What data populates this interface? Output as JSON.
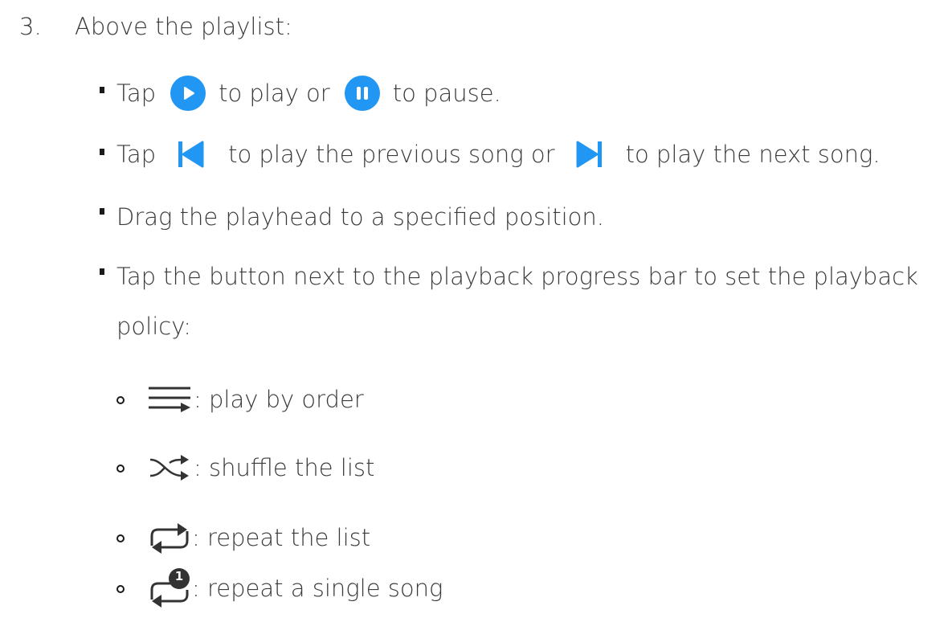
{
  "step": {
    "number": "3.",
    "title": "Above the playlist:"
  },
  "bullets": {
    "play_pause": {
      "tap": "Tap",
      "mid": "to play or",
      "end": "to pause."
    },
    "prev_next": {
      "tap": "Tap",
      "mid": "to play the previous song or",
      "end": "to play the next song."
    },
    "drag": "Drag the playhead to a specified position.",
    "policy_line1": "Tap the button next to the playback progress bar to set the playback",
    "policy_line2": "policy:"
  },
  "policies": [
    {
      "icon": "play-by-order-icon",
      "label": ": play by order"
    },
    {
      "icon": "shuffle-icon",
      "label": ": shuffle the list"
    },
    {
      "icon": "repeat-list-icon",
      "label": ": repeat the list"
    },
    {
      "icon": "repeat-single-icon",
      "label": ": repeat a single song",
      "badge": "1"
    }
  ],
  "colors": {
    "accent": "#2196F3",
    "text": "#3a3a3a",
    "icon_dark": "#333333"
  }
}
